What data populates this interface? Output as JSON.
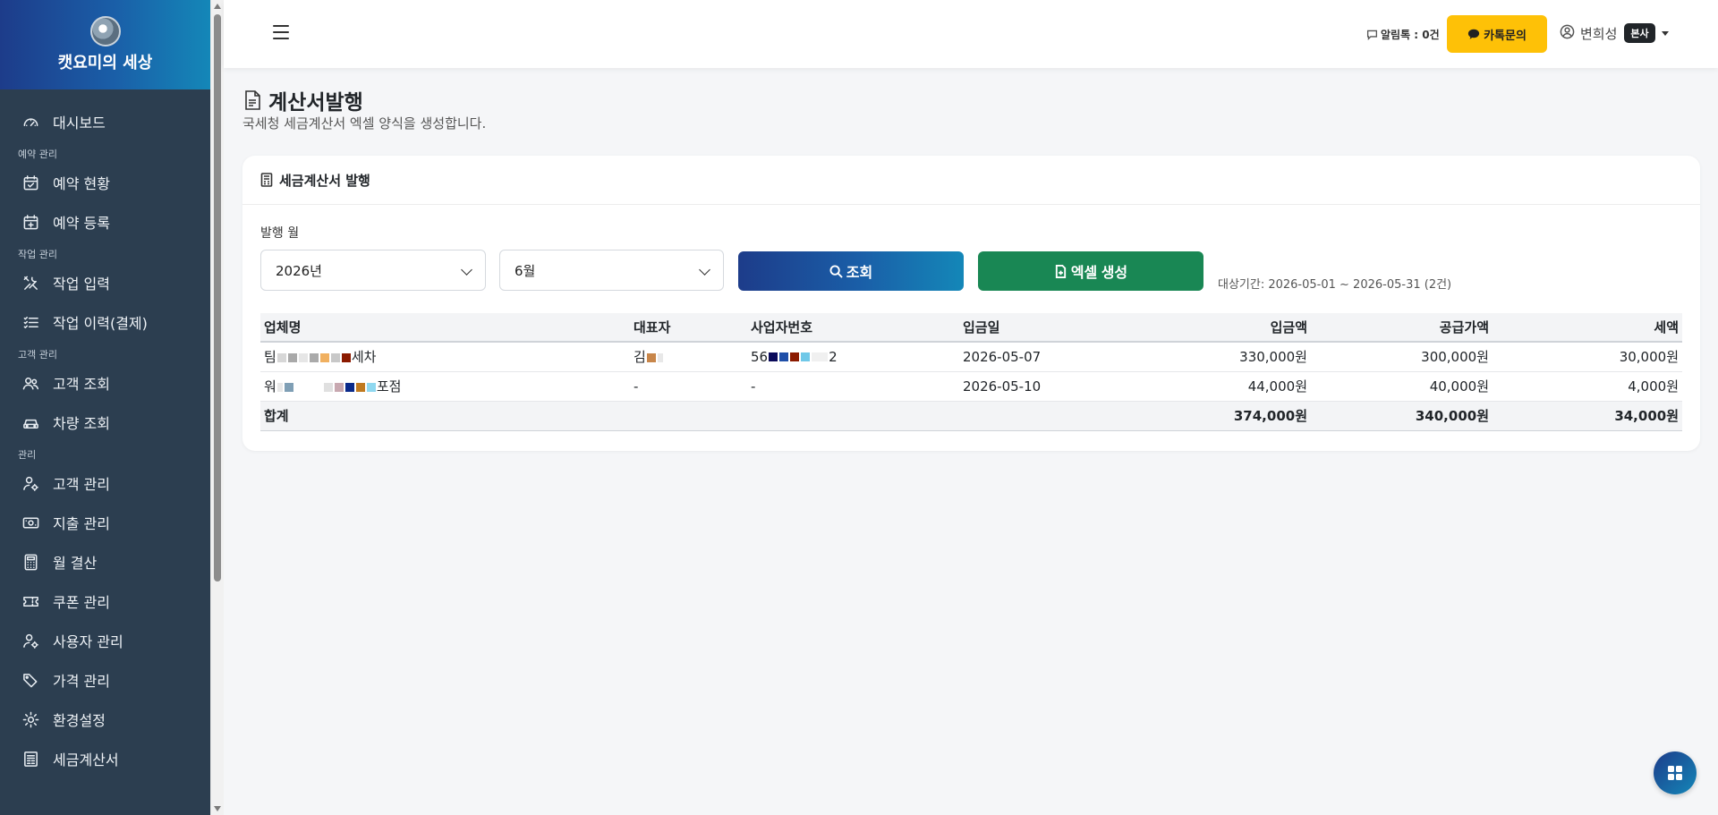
{
  "sidebar": {
    "brand_title": "캣요미의 세상",
    "items": [
      {
        "type": "item",
        "label": "대시보드",
        "icon": "gauge-icon"
      },
      {
        "type": "section",
        "label": "예약 관리"
      },
      {
        "type": "item",
        "label": "예약 현황",
        "icon": "calendar-check-icon"
      },
      {
        "type": "item",
        "label": "예약 등록",
        "icon": "calendar-plus-icon"
      },
      {
        "type": "section",
        "label": "작업 관리"
      },
      {
        "type": "item",
        "label": "작업 입력",
        "icon": "tools-icon"
      },
      {
        "type": "item",
        "label": "작업 이력(결제)",
        "icon": "list-check-icon"
      },
      {
        "type": "section",
        "label": "고객 관리"
      },
      {
        "type": "item",
        "label": "고객 조회",
        "icon": "users-icon"
      },
      {
        "type": "item",
        "label": "차량 조회",
        "icon": "car-icon"
      },
      {
        "type": "section",
        "label": "관리"
      },
      {
        "type": "item",
        "label": "고객 관리",
        "icon": "user-gear-icon"
      },
      {
        "type": "item",
        "label": "지출 관리",
        "icon": "cash-icon"
      },
      {
        "type": "item",
        "label": "월 결산",
        "icon": "calculator-icon"
      },
      {
        "type": "item",
        "label": "쿠폰 관리",
        "icon": "ticket-icon"
      },
      {
        "type": "item",
        "label": "사용자 관리",
        "icon": "user-gear-icon"
      },
      {
        "type": "item",
        "label": "가격 관리",
        "icon": "tags-icon"
      },
      {
        "type": "item",
        "label": "환경설정",
        "icon": "gear-icon"
      },
      {
        "type": "item",
        "label": "세금계산서",
        "icon": "receipt-icon"
      }
    ]
  },
  "topbar": {
    "alim_label": "알림톡 : 0건",
    "kakao_label": "카톡문의",
    "user_name": "변희성",
    "user_badge": "본사"
  },
  "page": {
    "title": "계산서발행",
    "subtitle": "국세청 세금계산서 엑셀 양식을 생성합니다."
  },
  "card": {
    "title": "세금계산서 발행",
    "field_label": "발행 월",
    "year_value": "2026년",
    "month_value": "6월",
    "search_label": "조회",
    "excel_label": "엑셀 생성",
    "period_text": "대상기간: 2026-05-01 ~ 2026-05-31 (2건)"
  },
  "table": {
    "headers": [
      "업체명",
      "대표자",
      "사업자번호",
      "입금일",
      "입금액",
      "공급가액",
      "세액"
    ],
    "rows": [
      {
        "company_prefix": "팀",
        "company_suffix": "세차",
        "rep_prefix": "김",
        "rep_suffix": "",
        "bizno_prefix": "56",
        "bizno_suffix": "2",
        "date": "2026-05-07",
        "deposit": "330,000원",
        "supply": "300,000원",
        "tax": "30,000원"
      },
      {
        "company_prefix": "워",
        "company_suffix": "포점",
        "rep_prefix": "-",
        "rep_suffix": "",
        "bizno_prefix": "-",
        "bizno_suffix": "",
        "date": "2026-05-10",
        "deposit": "44,000원",
        "supply": "40,000원",
        "tax": "4,000원"
      }
    ],
    "total": {
      "label": "합계",
      "deposit": "374,000원",
      "supply": "340,000원",
      "tax": "34,000원"
    }
  },
  "colors": {
    "sidebar_bg": "#2c3e50",
    "accent_gradient_start": "#1d3c8a",
    "accent_gradient_end": "#1487b8",
    "excel_green": "#198754",
    "kakao_yellow": "#fec107"
  }
}
